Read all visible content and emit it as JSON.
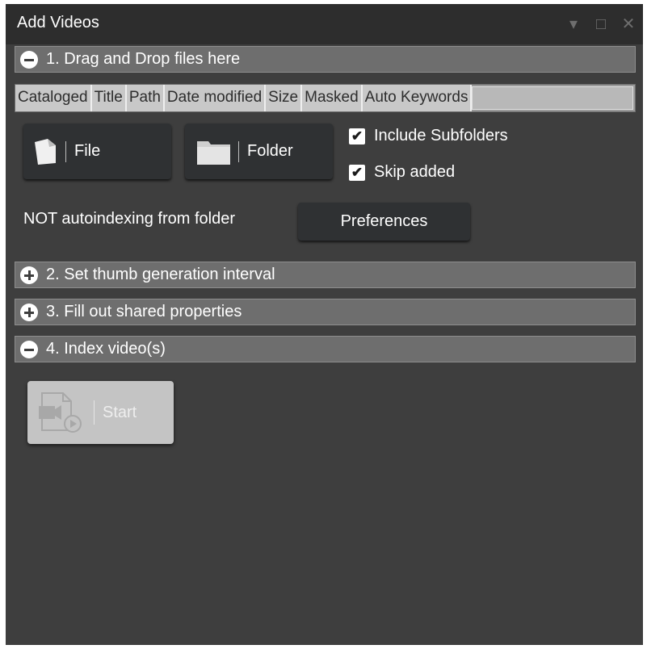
{
  "window": {
    "title": "Add Videos",
    "controls": {
      "dropdown": "▾",
      "maximize": "□",
      "close": "✕"
    }
  },
  "sections": [
    {
      "label": "1. Drag and Drop files here",
      "state": "expanded"
    },
    {
      "label": "2. Set thumb generation interval",
      "state": "collapsed"
    },
    {
      "label": "3. Fill out shared properties",
      "state": "collapsed"
    },
    {
      "label": "4. Index video(s)",
      "state": "expanded"
    }
  ],
  "file_table": {
    "columns": [
      "Cataloged",
      "Title",
      "Path",
      "Date modified",
      "Size",
      "Masked",
      "Auto Keywords"
    ]
  },
  "buttons": {
    "file": {
      "label": "File",
      "icon": "document-icon"
    },
    "folder": {
      "label": "Folder",
      "icon": "folder-icon"
    },
    "preferences": {
      "label": "Preferences"
    },
    "start": {
      "label": "Start",
      "icon": "video-play-icon",
      "enabled": false
    }
  },
  "options": {
    "include_subfolders": {
      "label": "Include Subfolders",
      "checked": true
    },
    "skip_added": {
      "label": "Skip added",
      "checked": true
    }
  },
  "status": {
    "autoindex": "NOT autoindexing from folder"
  },
  "colors": {
    "panel_bg": "#3e3e3e",
    "header_bg": "#6e6e6e",
    "button_bg": "#2f3133",
    "disabled_button_bg": "#c4c4c4"
  }
}
